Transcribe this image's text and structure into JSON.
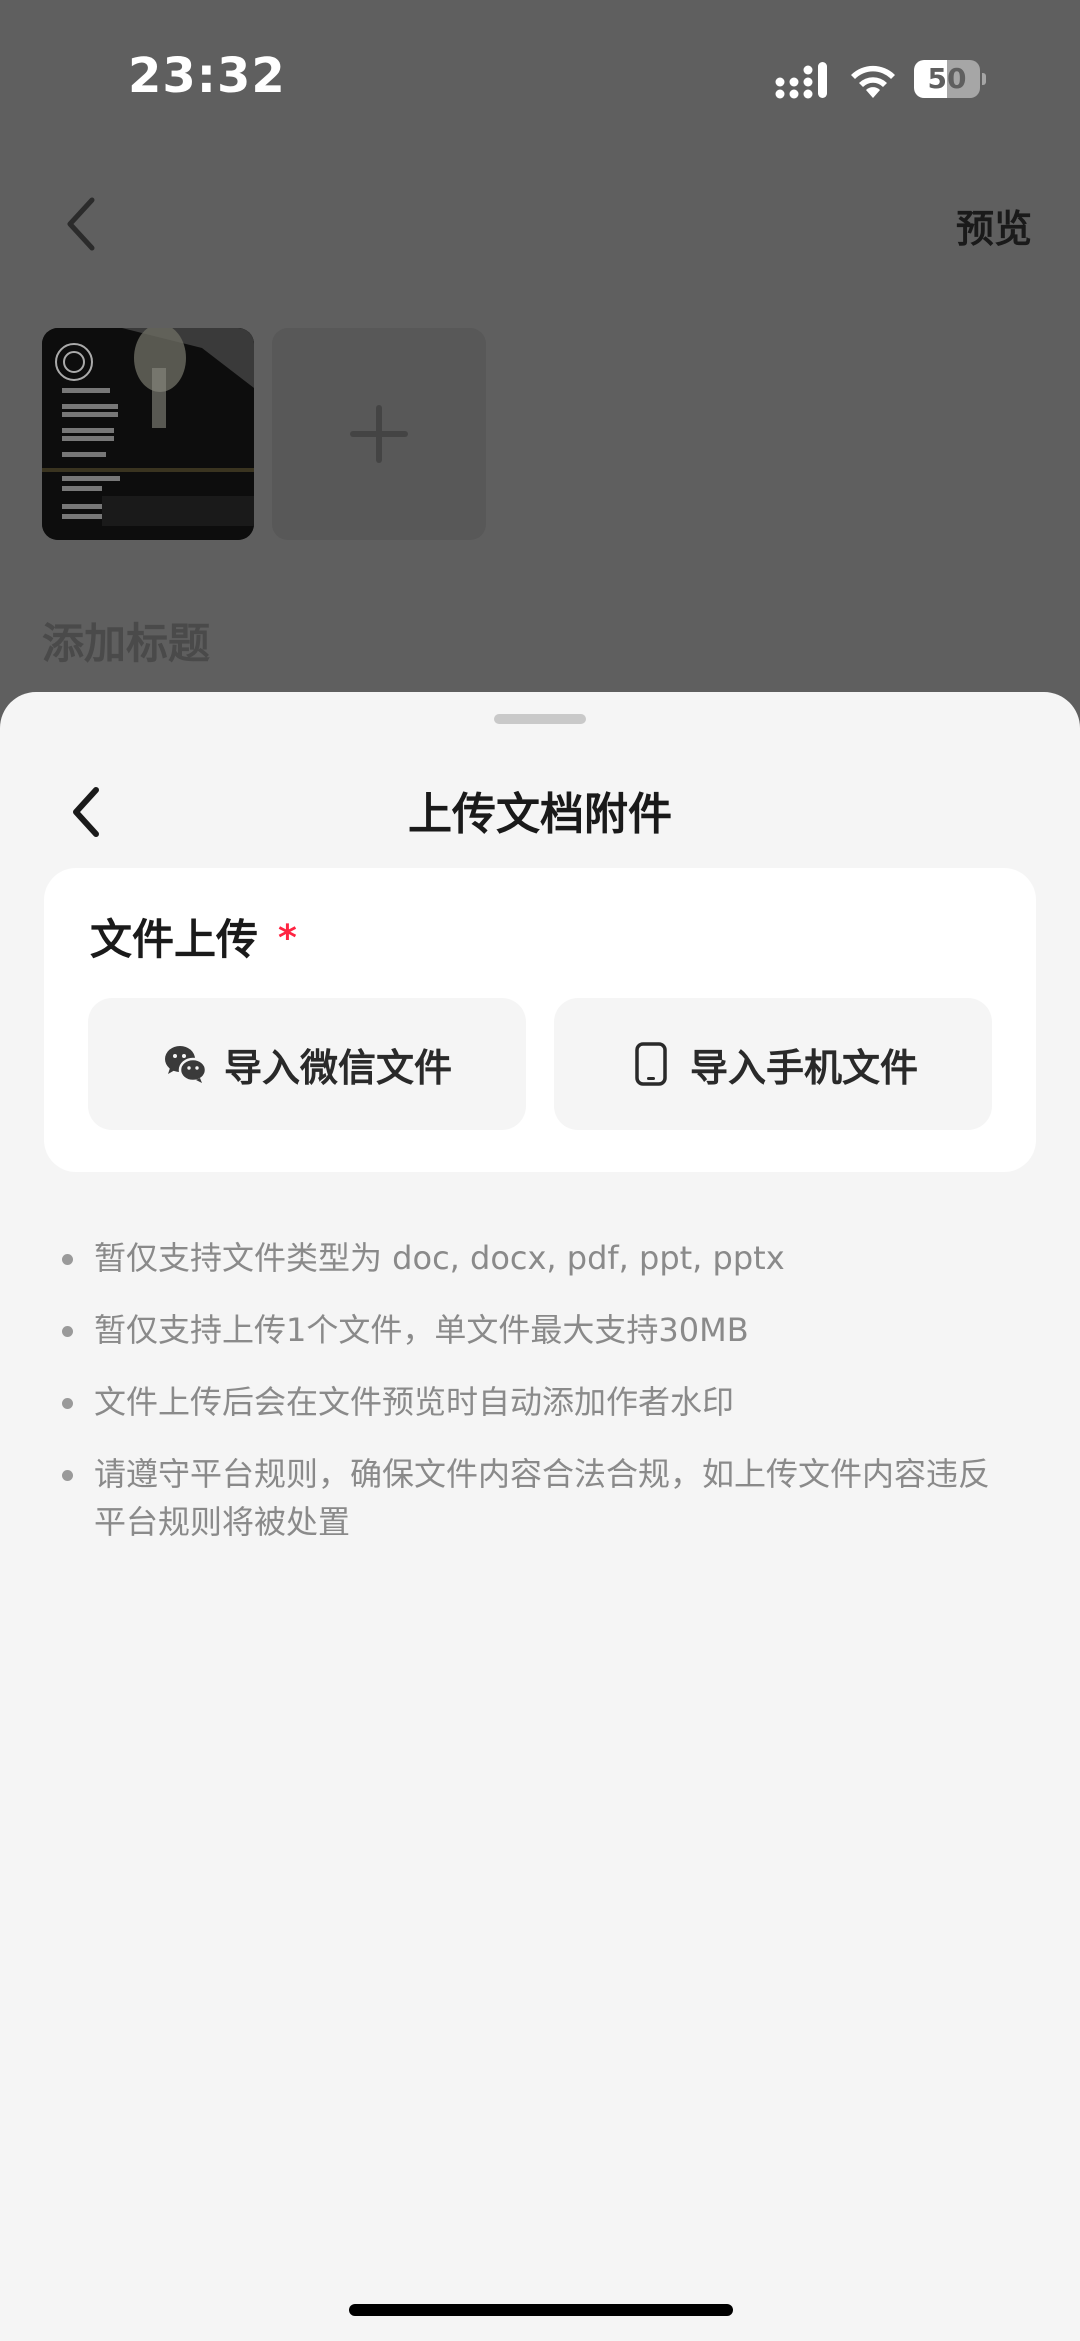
{
  "status_bar": {
    "time": "23:32",
    "battery": "50",
    "battery_level": 0.5
  },
  "background_page": {
    "preview_label": "预览",
    "title_placeholder": "添加标题",
    "add_image_icon": "plus-icon",
    "back_icon": "chevron-left-icon"
  },
  "sheet": {
    "title": "上传文档附件",
    "upload_card": {
      "label": "文件上传",
      "required_mark": "*",
      "buttons": [
        {
          "label": "导入微信文件",
          "icon": "wechat-icon"
        },
        {
          "label": "导入手机文件",
          "icon": "phone-icon"
        }
      ]
    },
    "notes": [
      "暂仅支持文件类型为 doc, docx, pdf, ppt, pptx",
      "暂仅支持上传1个文件，单文件最大支持30MB",
      "文件上传后会在文件预览时自动添加作者水印",
      "请遵守平台规则，确保文件内容合法合规，如上传文件内容违反平台规则将被处置"
    ]
  },
  "colors": {
    "accent_required": "#ff2442",
    "overlay_dim": "#5f5f5f",
    "sheet_background": "#f5f5f5",
    "card_background": "#ffffff"
  }
}
